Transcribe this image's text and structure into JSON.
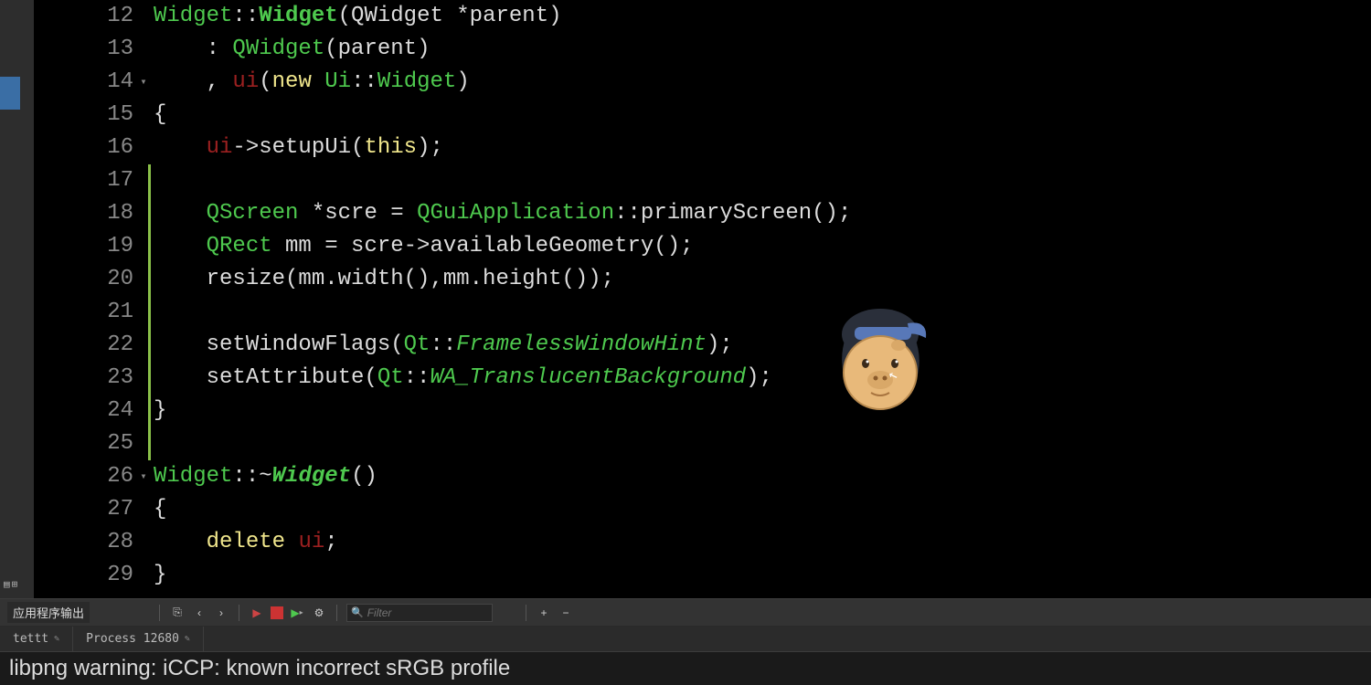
{
  "gutter": {
    "start": 12,
    "end": 29,
    "fold_lines": [
      14,
      26
    ]
  },
  "code_lines": [
    {
      "n": 12,
      "bar": false,
      "html": [
        [
          "type",
          "Widget"
        ],
        [
          "plain",
          "::"
        ],
        [
          "fn-bold",
          "Widget"
        ],
        [
          "plain",
          "(QWidget *parent)"
        ]
      ]
    },
    {
      "n": 13,
      "bar": false,
      "html": [
        [
          "plain",
          "    : "
        ],
        [
          "type",
          "QWidget"
        ],
        [
          "plain",
          "(parent)"
        ]
      ]
    },
    {
      "n": 14,
      "bar": false,
      "html": [
        [
          "plain",
          "    , "
        ],
        [
          "member",
          "ui"
        ],
        [
          "plain",
          "("
        ],
        [
          "kw",
          "new"
        ],
        [
          "plain",
          " "
        ],
        [
          "type",
          "Ui"
        ],
        [
          "plain",
          "::"
        ],
        [
          "type",
          "Widget"
        ],
        [
          "plain",
          ")"
        ]
      ]
    },
    {
      "n": 15,
      "bar": false,
      "html": [
        [
          "plain",
          "{"
        ]
      ]
    },
    {
      "n": 16,
      "bar": false,
      "html": [
        [
          "plain",
          "    "
        ],
        [
          "member",
          "ui"
        ],
        [
          "plain",
          "->setupUi("
        ],
        [
          "kw",
          "this"
        ],
        [
          "plain",
          ");"
        ]
      ]
    },
    {
      "n": 17,
      "bar": true,
      "html": []
    },
    {
      "n": 18,
      "bar": true,
      "html": [
        [
          "plain",
          "    "
        ],
        [
          "type",
          "QScreen"
        ],
        [
          "plain",
          " *scre = "
        ],
        [
          "type",
          "QGuiApplication"
        ],
        [
          "plain",
          "::primaryScreen();"
        ]
      ]
    },
    {
      "n": 19,
      "bar": true,
      "html": [
        [
          "plain",
          "    "
        ],
        [
          "type",
          "QRect"
        ],
        [
          "plain",
          " mm = scre->availableGeometry();"
        ]
      ]
    },
    {
      "n": 20,
      "bar": true,
      "html": [
        [
          "plain",
          "    resize(mm.width(),mm.height());"
        ]
      ]
    },
    {
      "n": 21,
      "bar": true,
      "html": []
    },
    {
      "n": 22,
      "bar": true,
      "html": [
        [
          "plain",
          "    setWindowFlags("
        ],
        [
          "type",
          "Qt"
        ],
        [
          "plain",
          "::"
        ],
        [
          "enum",
          "FramelessWindowHint"
        ],
        [
          "plain",
          ");"
        ]
      ]
    },
    {
      "n": 23,
      "bar": true,
      "html": [
        [
          "plain",
          "    setAttribute("
        ],
        [
          "type",
          "Qt"
        ],
        [
          "plain",
          "::"
        ],
        [
          "enum",
          "WA_TranslucentBackground"
        ],
        [
          "plain",
          ");"
        ]
      ]
    },
    {
      "n": 24,
      "bar": true,
      "html": [
        [
          "plain",
          "}"
        ]
      ]
    },
    {
      "n": 25,
      "bar": true,
      "html": []
    },
    {
      "n": 26,
      "bar": false,
      "html": [
        [
          "type",
          "Widget"
        ],
        [
          "plain",
          "::~"
        ],
        [
          "fn-italic",
          "Widget"
        ],
        [
          "plain",
          "()"
        ]
      ]
    },
    {
      "n": 27,
      "bar": false,
      "html": [
        [
          "plain",
          "{"
        ]
      ]
    },
    {
      "n": 28,
      "bar": false,
      "html": [
        [
          "plain",
          "    "
        ],
        [
          "kw",
          "delete"
        ],
        [
          "plain",
          " "
        ],
        [
          "member",
          "ui"
        ],
        [
          "plain",
          ";"
        ]
      ]
    },
    {
      "n": 29,
      "bar": false,
      "html": [
        [
          "plain",
          "}"
        ]
      ]
    }
  ],
  "panel": {
    "title": "应用程序输出",
    "filter_placeholder": "Filter",
    "tabs": [
      {
        "label": "tettt"
      },
      {
        "label": "Process 12680"
      }
    ],
    "output": "libpng warning: iCCP: known incorrect sRGB profile"
  },
  "toolbar": {
    "plus": "+",
    "minus": "−"
  }
}
